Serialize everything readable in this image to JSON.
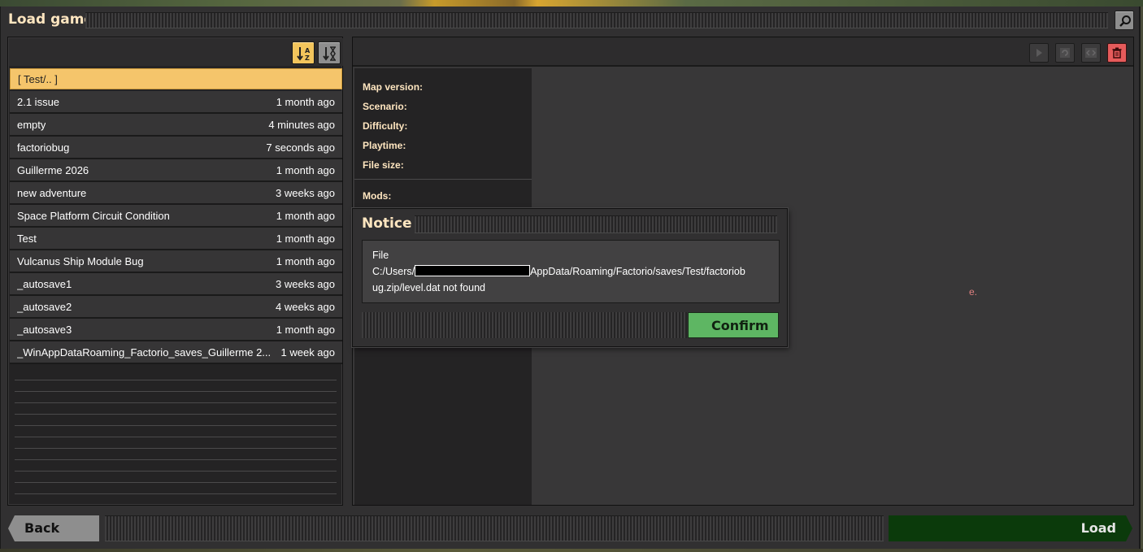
{
  "window": {
    "title": "Load game"
  },
  "sort": {
    "by_name_icon": "sort-alpha-icon",
    "by_time_icon": "sort-time-icon"
  },
  "saves": [
    {
      "name": "[ Test/.. ]",
      "time": ""
    },
    {
      "name": "2.1 issue",
      "time": "1 month ago"
    },
    {
      "name": "empty",
      "time": "4 minutes ago"
    },
    {
      "name": "factoriobug",
      "time": "7 seconds ago"
    },
    {
      "name": "Guillerme 2026",
      "time": "1 month ago"
    },
    {
      "name": "new adventure",
      "time": "3 weeks ago"
    },
    {
      "name": "Space Platform Circuit Condition",
      "time": "1 month ago"
    },
    {
      "name": "Test",
      "time": "1 month ago"
    },
    {
      "name": "Vulcanus Ship Module Bug",
      "time": "1 month ago"
    },
    {
      "name": "_autosave1",
      "time": "3 weeks ago"
    },
    {
      "name": "_autosave2",
      "time": "4 weeks ago"
    },
    {
      "name": "_autosave3",
      "time": "1 month ago"
    },
    {
      "name": "_WinAppDataRoaming_Factorio_saves_Guillerme 2...",
      "time": "1 week ago"
    }
  ],
  "info": {
    "map_version": "Map version:",
    "scenario": "Scenario:",
    "difficulty": "Difficulty:",
    "playtime": "Playtime:",
    "file_size": "File size:",
    "mods": "Mods:"
  },
  "stray_text": "e.",
  "notice": {
    "title": "Notice",
    "line1": "File",
    "line2_prefix": "C:/Users/",
    "line2_suffix": "AppData/Roaming/Factorio/saves/Test/factoriob",
    "line3": "ug.zip/level.dat not found",
    "confirm": "Confirm"
  },
  "footer": {
    "back": "Back",
    "load": "Load"
  },
  "colors": {
    "accent": "#f5c56b",
    "confirm": "#5eb663",
    "delete": "#e65b5b",
    "load": "#0b3a0b"
  }
}
